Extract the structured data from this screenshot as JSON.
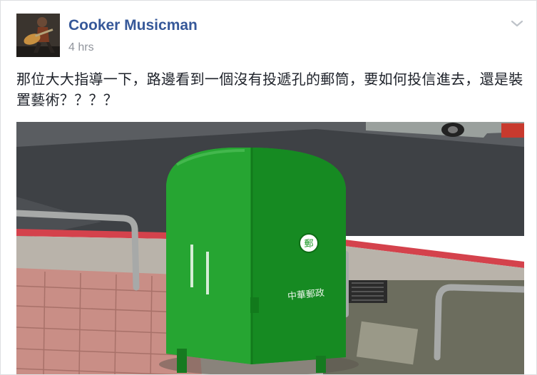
{
  "post": {
    "author_name": "Cooker Musicman",
    "timestamp": "4 hrs",
    "text": "那位大大指導一下，路邊看到一個沒有投遞孔的郵筒，要如何投信進去，還是裝置藝術？？？？",
    "options_icon": "chevron-down-icon",
    "avatar_icon": "guitarist-avatar"
  },
  "photo": {
    "description_icon": "green-mailbox-photo",
    "mailbox_stencil_text": "中華郵政",
    "colors": {
      "mailbox_green": "#1f9a2a",
      "road_asphalt": "#3e4145",
      "curb_red": "#d4424c",
      "pavement_brick": "#c98e86"
    }
  },
  "colors": {
    "author_link": "#365899",
    "timestamp_gray": "#90949c",
    "body_text": "#1d2129"
  }
}
